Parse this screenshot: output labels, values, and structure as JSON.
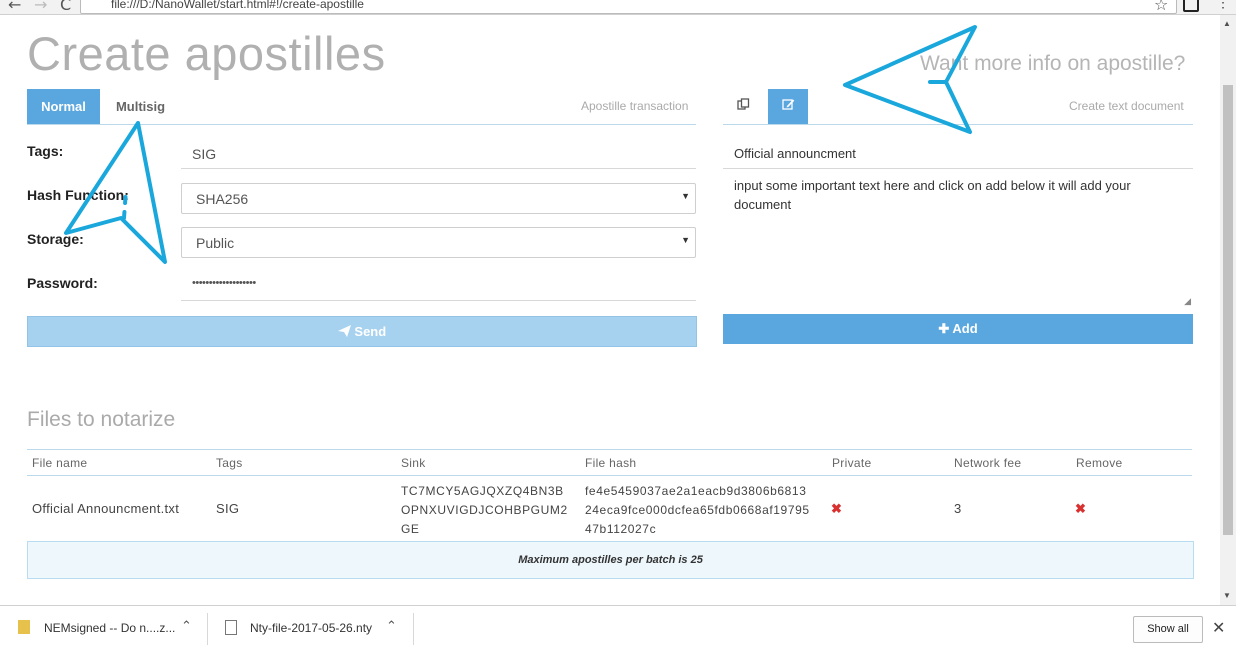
{
  "browser": {
    "url": "file:///D:/NanoWallet/start.html#!/create-apostille",
    "back": "←",
    "forward": "→",
    "reload": "C",
    "star": "☆"
  },
  "page": {
    "title": "Create apostilles",
    "more_info": "Want more info on apostille?"
  },
  "left_panel": {
    "tabs": [
      "Normal",
      "Multisig"
    ],
    "label": "Apostille transaction",
    "fields": {
      "tags_label": "Tags:",
      "tags_value": "SIG",
      "hash_label": "Hash Function:",
      "hash_value": "SHA256",
      "storage_label": "Storage:",
      "storage_value": "Public",
      "password_label": "Password:",
      "password_value": "•••••••••••••••••••"
    },
    "send_label": "Send",
    "send_icon": "paper-plane-icon"
  },
  "right_panel": {
    "label": "Create text document",
    "icons": [
      "copy-icon",
      "edit-icon"
    ],
    "doc_name": "Official announcment",
    "doc_text": "input some important text here and click on add below it will add your document",
    "add_label": "Add"
  },
  "files": {
    "heading": "Files to notarize",
    "columns": [
      "File name",
      "Tags",
      "Sink",
      "File hash",
      "Private",
      "Network fee",
      "Remove"
    ],
    "rows": [
      {
        "file_name": "Official Announcment.txt",
        "tags": "SIG",
        "sink_lines": [
          "TC7MCY5AGJQXZQ4BN3B",
          "OPNXUVIGDJCOHBPGUM2",
          "GE"
        ],
        "hash_lines": [
          "fe4e5459037ae2a1eacb9d3806b6813",
          "24eca9fce000dcfea65fdb0668af19795",
          "47b112027c"
        ],
        "private": "✖",
        "fee": "3",
        "remove": "✖"
      }
    ],
    "batch_note": "Maximum apostilles per batch is 25"
  },
  "downloads": {
    "items": [
      "NEMsigned -- Do n....z...",
      "Nty-file-2017-05-26.nty"
    ],
    "show_all": "Show all",
    "close": "✕"
  },
  "colors": {
    "accent": "#5aa7df",
    "arrow": "#1aa7dc",
    "remove": "#d9312f"
  }
}
